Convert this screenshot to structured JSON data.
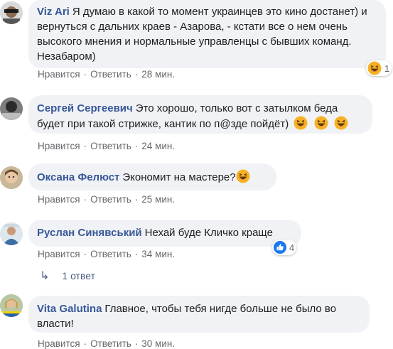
{
  "comments": [
    {
      "author": "Viz Ari",
      "text": "Я думаю в какой то момент украинцев это кино достанет) и вернуться с дальних краев - Азарова, - кстати все о нем очень высокого мнения и нормальные управленцы с бывших команд. Незабаром)",
      "like": "Нравится",
      "reply": "Ответить",
      "time": "28 мин.",
      "reaction": {
        "type": "haha",
        "count": "1"
      }
    },
    {
      "author": "Сергей Сергеевич",
      "text": "Это хорошо, только вот с затылком беда будет при такой стрижке, кантик по п@зде пойдёт)",
      "like": "Нравится",
      "reply": "Ответить",
      "time": "24 мин.",
      "trailing_emoji": [
        "haha",
        "haha",
        "haha"
      ]
    },
    {
      "author": "Оксана Фелюст",
      "text": "Экономит на мастере?",
      "like": "Нравится",
      "reply": "Ответить",
      "time": "25 мин.",
      "trailing_emoji": [
        "haha"
      ]
    },
    {
      "author": "Руслан Синявський",
      "text": "Нехай буде Кличко краще",
      "like": "Нравится",
      "reply": "Ответить",
      "time": "34 мин.",
      "reaction": {
        "type": "like",
        "count": "4"
      },
      "replies_label": "1 ответ"
    },
    {
      "author": "Vita Galutina",
      "text": "Главное, чтобы тебя нигде больше не было во власти!",
      "like": "Нравится",
      "reply": "Ответить",
      "time": "30 мин."
    }
  ],
  "colors": {
    "author": "#385898",
    "bubble": "#f0f2f5",
    "meta": "#65676b",
    "like_blue": "#1877f2",
    "haha_yellow": "#f7b125"
  },
  "icons": {
    "reply_arrow": "reply-arrow-icon",
    "haha": "haha-emoji-icon",
    "like": "like-reaction-icon"
  }
}
